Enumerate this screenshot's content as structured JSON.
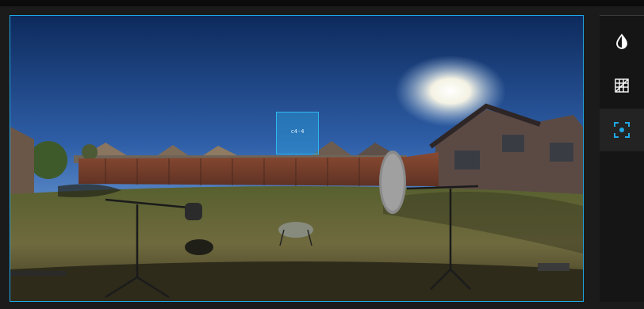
{
  "viewer": {
    "focus_box_text": "c4·4",
    "accent": "#20a8e6"
  },
  "toolbar": {
    "tools": [
      {
        "name": "exposure",
        "icon": "contrast-drop-icon",
        "active": false
      },
      {
        "name": "grid",
        "icon": "grid-perspective-icon",
        "active": false
      },
      {
        "name": "focus",
        "icon": "focus-target-icon",
        "active": true
      }
    ]
  }
}
